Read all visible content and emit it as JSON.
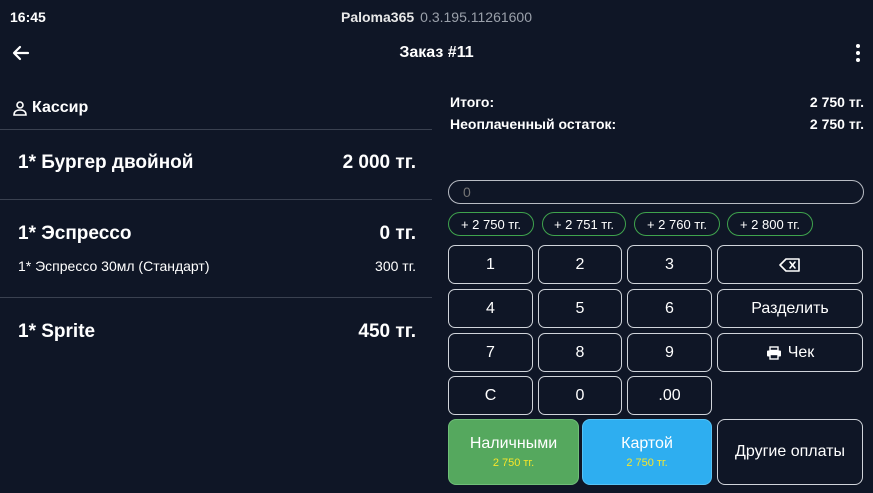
{
  "status_bar": {
    "time": "16:45",
    "app_name": "Paloma365",
    "version": "0.3.195.11261600"
  },
  "toolbar": {
    "title": "Заказ #11",
    "back_icon": "arrow-left-icon",
    "menu_icon": "more-vertical-icon"
  },
  "cashier": {
    "icon": "person-icon",
    "label": "Кассир"
  },
  "order_items": [
    {
      "name": "1* Бургер двойной",
      "price": "2 000  тг."
    },
    {
      "name": "1* Эспрессо",
      "price": "0  тг.",
      "sub_name": "1* Эспрессо 30мл (Стандарт)",
      "sub_price": "300  тг."
    },
    {
      "name": "1* Sprite",
      "price": "450  тг."
    }
  ],
  "summary": {
    "total_label": "Итого:",
    "total_value": "2 750  тг.",
    "unpaid_label": "Неоплаченный остаток:",
    "unpaid_value": "2 750  тг."
  },
  "amount_input": {
    "value": "",
    "placeholder": "0"
  },
  "quick_amounts": [
    "+ 2 750  тг.",
    "+ 2 751  тг.",
    "+ 2 760  тг.",
    "+ 2 800  тг."
  ],
  "keypad": {
    "k1": "1",
    "k2": "2",
    "k3": "3",
    "k4": "4",
    "k5": "5",
    "k6": "6",
    "k7": "7",
    "k8": "8",
    "k9": "9",
    "kc": "C",
    "k0": "0",
    "k00": ".00",
    "backspace_icon": "backspace-icon",
    "split": "Разделить",
    "receipt": "Чек",
    "receipt_icon": "printer-icon"
  },
  "payments": {
    "cash_label": "Наличными",
    "cash_amount": "2 750  тг.",
    "card_label": "Картой",
    "card_amount": "2 750  тг.",
    "other_label": "Другие оплаты"
  },
  "colors": {
    "background": "#0f1626",
    "cash_green": "#55a85e",
    "card_blue": "#2eaef0",
    "chip_border": "#3fa34d",
    "amount_yellow": "#f7e62a"
  }
}
